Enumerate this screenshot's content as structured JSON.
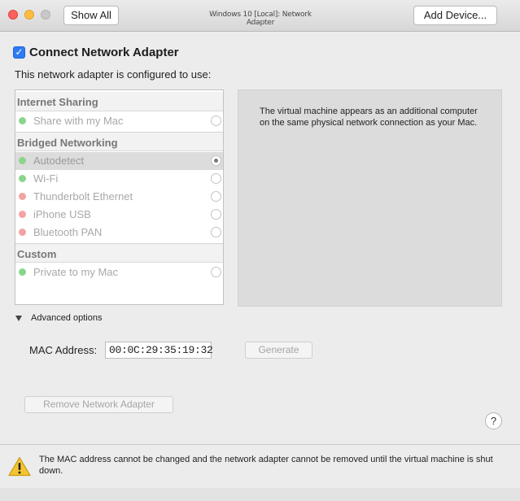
{
  "window": {
    "title": "Windows 10 [Local]: Network Adapter",
    "show_all_label": "Show All",
    "add_device_label": "Add Device..."
  },
  "adapter": {
    "connect_label": "Connect Network Adapter",
    "connect_checked": true,
    "configured_label": "This network adapter is configured to use:"
  },
  "network_list": {
    "internet_sharing": {
      "header": "Internet Sharing",
      "items": [
        {
          "label": "Share with my Mac",
          "status": "green",
          "selected": false
        }
      ]
    },
    "bridged": {
      "header": "Bridged Networking",
      "items": [
        {
          "label": "Autodetect",
          "status": "green",
          "selected": true
        },
        {
          "label": "Wi-Fi",
          "status": "green",
          "selected": false
        },
        {
          "label": "Thunderbolt Ethernet",
          "status": "red",
          "selected": false
        },
        {
          "label": "iPhone USB",
          "status": "red",
          "selected": false
        },
        {
          "label": "Bluetooth PAN",
          "status": "red",
          "selected": false
        }
      ]
    },
    "custom": {
      "header": "Custom",
      "items": [
        {
          "label": "Private to my Mac",
          "status": "green",
          "selected": false
        }
      ]
    }
  },
  "description": "The virtual machine appears as an additional computer on the same physical network connection as your Mac.",
  "advanced": {
    "label": "Advanced options",
    "mac_label": "MAC Address:",
    "mac_value": "00:0C:29:35:19:32",
    "generate_label": "Generate"
  },
  "remove_label": "Remove Network Adapter",
  "help_label": "?",
  "footer": {
    "icon": "warning-icon",
    "message": "The MAC address cannot be changed and the network adapter cannot be removed until the virtual machine is shut down."
  },
  "colors": {
    "status_green": "#8ad58c",
    "status_red": "#f3a3a2",
    "checkbox_blue": "#2f7bf5"
  }
}
